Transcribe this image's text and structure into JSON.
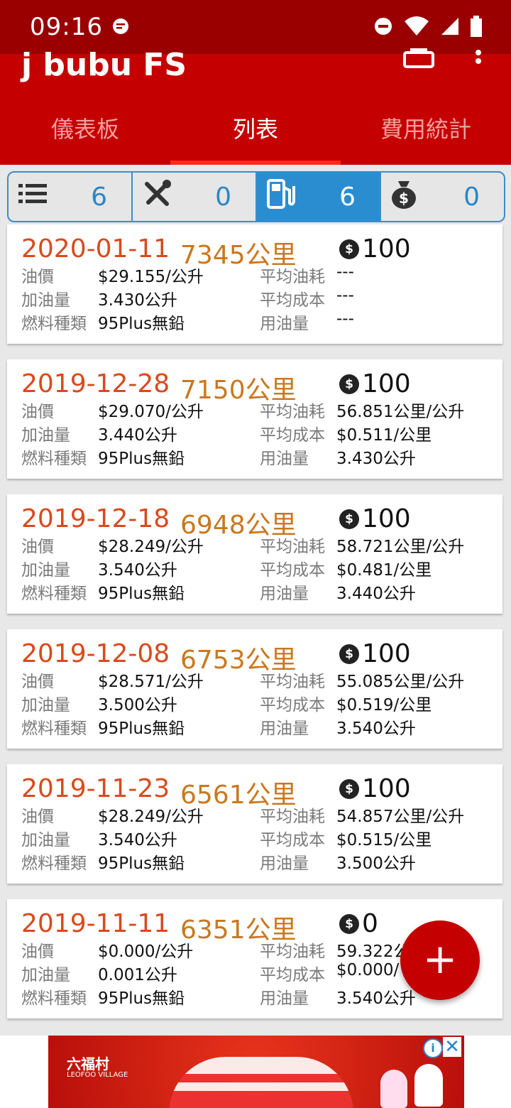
{
  "status": {
    "time": "09:16"
  },
  "app": {
    "title": "j bubu FS"
  },
  "tabs": [
    {
      "label": "儀表板",
      "active": false
    },
    {
      "label": "列表",
      "active": true
    },
    {
      "label": "費用統計",
      "active": false
    }
  ],
  "filters": [
    {
      "icon": "list-icon",
      "count": "6",
      "active": false
    },
    {
      "icon": "tools-icon",
      "count": "0",
      "active": false
    },
    {
      "icon": "fuel-pump-icon",
      "count": "6",
      "active": true
    },
    {
      "icon": "money-bag-icon",
      "count": "0",
      "active": false
    }
  ],
  "labels": {
    "price": "油價",
    "amount": "加油量",
    "fuel_type": "燃料種類",
    "avg_consumption": "平均油耗",
    "avg_cost": "平均成本",
    "fuel_used": "用油量"
  },
  "records": [
    {
      "date": "2020-01-11",
      "odometer": "7345公里",
      "cost": "100",
      "price": "$29.155/公升",
      "amount": "3.430公升",
      "fuel_type": "95Plus無鉛",
      "avg_consumption": "---",
      "avg_cost": "---",
      "fuel_used": "---"
    },
    {
      "date": "2019-12-28",
      "odometer": "7150公里",
      "cost": "100",
      "price": "$29.070/公升",
      "amount": "3.440公升",
      "fuel_type": "95Plus無鉛",
      "avg_consumption": "56.851公里/公升",
      "avg_cost": "$0.511/公里",
      "fuel_used": "3.430公升"
    },
    {
      "date": "2019-12-18",
      "odometer": "6948公里",
      "cost": "100",
      "price": "$28.249/公升",
      "amount": "3.540公升",
      "fuel_type": "95Plus無鉛",
      "avg_consumption": "58.721公里/公升",
      "avg_cost": "$0.481/公里",
      "fuel_used": "3.440公升"
    },
    {
      "date": "2019-12-08",
      "odometer": "6753公里",
      "cost": "100",
      "price": "$28.571/公升",
      "amount": "3.500公升",
      "fuel_type": "95Plus無鉛",
      "avg_consumption": "55.085公里/公升",
      "avg_cost": "$0.519/公里",
      "fuel_used": "3.540公升"
    },
    {
      "date": "2019-11-23",
      "odometer": "6561公里",
      "cost": "100",
      "price": "$28.249/公升",
      "amount": "3.540公升",
      "fuel_type": "95Plus無鉛",
      "avg_consumption": "54.857公里/公升",
      "avg_cost": "$0.515/公里",
      "fuel_used": "3.500公升"
    },
    {
      "date": "2019-11-11",
      "odometer": "6351公里",
      "cost": "0",
      "price": "$0.000/公升",
      "amount": "0.001公升",
      "fuel_type": "95Plus無鉛",
      "avg_consumption": "59.322公",
      "avg_cost": "$0.000/",
      "fuel_used": "3.540公升"
    }
  ],
  "fab": {
    "label": "+"
  },
  "ad": {
    "brand": "六福村",
    "brand_en": "LEOFOO VILLAGE",
    "info": "i",
    "close": "✕"
  },
  "colors": {
    "primary": "#c50000",
    "status_bar": "#9a0000",
    "accent_blue": "#2a8dd0",
    "date": "#d84a1e",
    "odometer": "#c9781e"
  }
}
